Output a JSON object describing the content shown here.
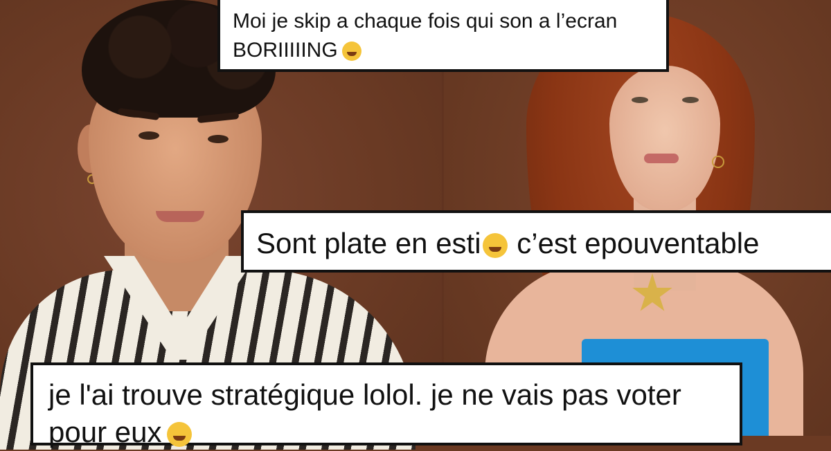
{
  "comments": [
    {
      "line1": "Moi je skip a chaque fois qui son a l’ecran",
      "line2": "BORIIIIING",
      "emoji": "sleeping-face-icon"
    },
    {
      "before": "Sont plate en esti",
      "after": " c’est epouventable",
      "emoji": "tears-of-joy-icon"
    },
    {
      "line1": "je l'ai trouve stratégique lolol. je ne vais pas voter",
      "line2": "pour eux",
      "emoji": "tears-of-joy-icon"
    }
  ],
  "colors": {
    "background": "#6b3a23",
    "comment_bg": "#ffffff",
    "comment_border": "#111111",
    "dress": "#1e8fd6"
  }
}
